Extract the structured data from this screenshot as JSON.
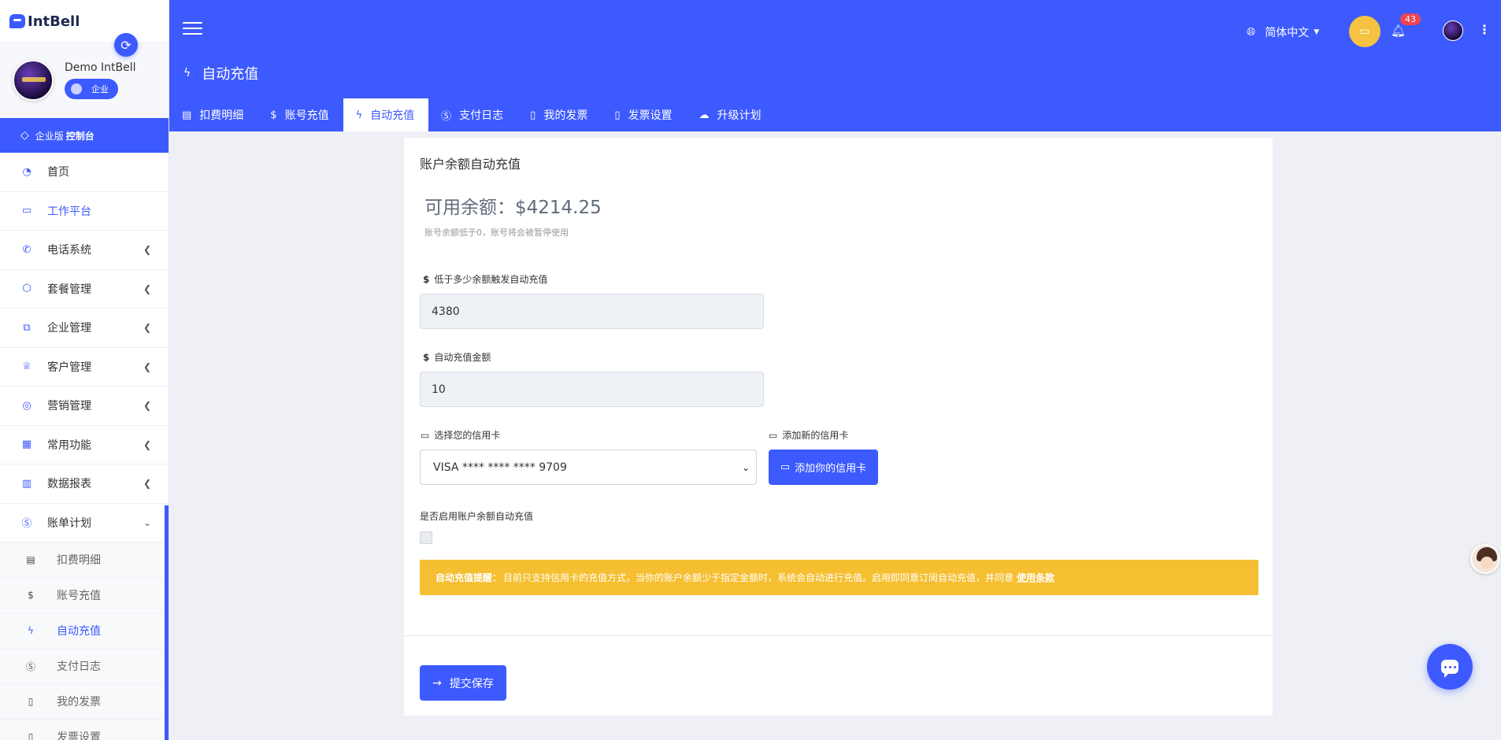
{
  "brand": {
    "name": "IntBell"
  },
  "user": {
    "name": "Demo IntBell",
    "role": "企业"
  },
  "console": {
    "prefix": "企业版",
    "label": "控制台"
  },
  "nav": {
    "items": [
      {
        "label": "首页",
        "icon": "dashboard-icon"
      },
      {
        "label": "工作平台",
        "icon": "laptop-icon"
      },
      {
        "label": "电话系统",
        "icon": "phone-icon"
      },
      {
        "label": "套餐管理",
        "icon": "package-icon"
      },
      {
        "label": "企业管理",
        "icon": "org-chart-icon"
      },
      {
        "label": "客户管理",
        "icon": "crown-icon"
      },
      {
        "label": "营销管理",
        "icon": "target-icon"
      },
      {
        "label": "常用功能",
        "icon": "grid-icon"
      },
      {
        "label": "数据报表",
        "icon": "bar-chart-icon"
      },
      {
        "label": "账单计划",
        "icon": "dollar-circle-icon"
      }
    ],
    "sub_items": [
      {
        "label": "扣费明细",
        "icon": "receipt-icon"
      },
      {
        "label": "账号充值",
        "icon": "dollar-icon"
      },
      {
        "label": "自动充值",
        "icon": "bolt-icon"
      },
      {
        "label": "支付日志",
        "icon": "dollar-circle-icon"
      },
      {
        "label": "我的发票",
        "icon": "invoice-icon"
      },
      {
        "label": "发票设置",
        "icon": "invoice-settings-icon"
      }
    ]
  },
  "header": {
    "title": "自动充值",
    "language": "简体中文",
    "notification_count": "43",
    "tabs": [
      {
        "label": "扣费明细",
        "icon": "receipt-icon"
      },
      {
        "label": "账号充值",
        "icon": "dollar-icon"
      },
      {
        "label": "自动充值",
        "icon": "bolt-icon"
      },
      {
        "label": "支付日志",
        "icon": "dollar-circle-icon"
      },
      {
        "label": "我的发票",
        "icon": "invoice-icon"
      },
      {
        "label": "发票设置",
        "icon": "invoice-settings-icon"
      },
      {
        "label": "升级计划",
        "icon": "cloud-icon"
      }
    ]
  },
  "form": {
    "card_title": "账户余额自动充值",
    "balance_text": "可用余额：$4214.25",
    "balance_note": "账号余额低于0，账号将会被暂停使用",
    "threshold_label": "低于多少余额触发自动充值",
    "threshold_value": "4380",
    "amount_label": "自动充值金额",
    "amount_value": "10",
    "card_select_label": "选择您的信用卡",
    "card_selected": "VISA **** **** **** 9709",
    "add_card_label": "添加新的信用卡",
    "add_card_button": "添加你的信用卡",
    "enable_label": "是否启用账户余额自动充值",
    "enabled": false,
    "notice_title": "自动充值提醒：",
    "notice_text": "目前只支持信用卡的充值方式，当你的账户余额少于指定金额时，系统会自动进行充值。启用即同意订阅自动充值，并同意",
    "notice_link": "使用条款",
    "submit_button": "提交保存"
  },
  "colors": {
    "primary": "#3d5afe",
    "warning": "#f5bf31",
    "badge": "#f04352"
  }
}
